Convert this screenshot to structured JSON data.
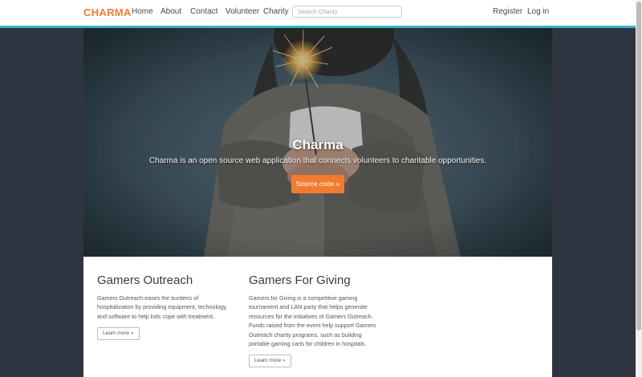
{
  "navbar": {
    "brand": "CHARMA",
    "links": [
      "Home",
      "About",
      "Contact",
      "Volunteer",
      "Charity"
    ],
    "search_placeholder": "Search Charity",
    "register": "Register",
    "login": "Log in",
    "accent_color": "#f27c2e",
    "border_color": "#3ab0bf"
  },
  "hero": {
    "title": "Charma",
    "text": "Charma is an open source web application that connects volunteers to charitable opportunities.",
    "button": "Source code »",
    "button_color": "#f27c2e"
  },
  "cards": [
    {
      "title": "Gamers Outreach",
      "lines": [
        "Gamers Outreach eases the burdens of",
        "hospitalization by providing equipment, technology,",
        "and software to help kids cope with treatment."
      ],
      "button": "Learn more »"
    },
    {
      "title": "Gamers For Giving",
      "lines": [
        "Gamers for Giving is a competitive gaming",
        "tournament and LAN party that helps generate",
        "resources for the initiatives of Gamers Outreach.",
        "Funds raised from the event help support Gamers",
        "Outreach charity programs, such as building",
        "portable gaming carts for children in hospitals."
      ],
      "button": "Learn more »"
    }
  ],
  "page_background": "#2e3540"
}
